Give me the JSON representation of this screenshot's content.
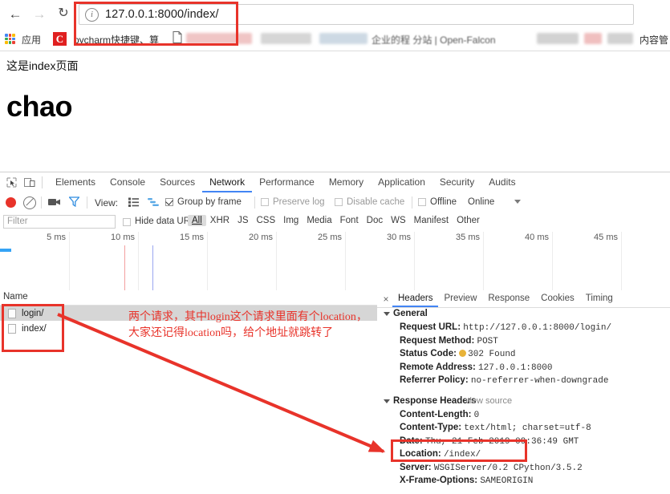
{
  "browser": {
    "back_icon": "back-arrow-icon",
    "forward_icon": "forward-arrow-icon",
    "reload_icon": "reload-icon",
    "info_icon": "ⓘ",
    "url": "127.0.0.1:8000/index/",
    "bookmarks": {
      "apps_label": "应用",
      "c_icon_letter": "C",
      "pycharm_label": "pycharm快捷键、算",
      "open_falcon_label": "企业的程      分站 | Open-Falcon",
      "rightmost_label": "内容管"
    }
  },
  "page": {
    "text": "这是index页面",
    "heading": "chao"
  },
  "devtools": {
    "inspect_icon": "inspect-element-icon",
    "device_toolbar_icon": "device-toolbar-icon",
    "tabs": [
      {
        "label": "Elements",
        "active": false
      },
      {
        "label": "Console",
        "active": false
      },
      {
        "label": "Sources",
        "active": false
      },
      {
        "label": "Network",
        "active": true
      },
      {
        "label": "Performance",
        "active": false
      },
      {
        "label": "Memory",
        "active": false
      },
      {
        "label": "Application",
        "active": false
      },
      {
        "label": "Security",
        "active": false
      },
      {
        "label": "Audits",
        "active": false
      }
    ],
    "toolbar": {
      "record_icon": "record-button-icon",
      "clear_icon": "clear-icon",
      "screenshot_icon": "camera-icon",
      "filter_icon": "funnel-filter-icon",
      "view_label": "View:",
      "view_list_icon": "list-view-icon",
      "view_waterfall_icon": "waterfall-view-icon",
      "group_by_frame_label": "Group by frame",
      "group_by_frame_checked": true,
      "preserve_log_label": "Preserve log",
      "preserve_log_checked": false,
      "disable_cache_label": "Disable cache",
      "disable_cache_checked": false,
      "offline_label": "Offline",
      "offline_checked": false,
      "online_label": "Online",
      "throttling_caret_icon": "chevron-down-icon"
    },
    "filter_row": {
      "placeholder": "Filter",
      "hide_data_urls_label": "Hide data URLs",
      "hide_data_urls_checked": false,
      "resource_types": [
        {
          "label": "All",
          "selected": true
        },
        {
          "label": "XHR",
          "selected": false
        },
        {
          "label": "JS",
          "selected": false
        },
        {
          "label": "CSS",
          "selected": false
        },
        {
          "label": "Img",
          "selected": false
        },
        {
          "label": "Media",
          "selected": false
        },
        {
          "label": "Font",
          "selected": false
        },
        {
          "label": "Doc",
          "selected": false
        },
        {
          "label": "WS",
          "selected": false
        },
        {
          "label": "Manifest",
          "selected": false
        },
        {
          "label": "Other",
          "selected": false
        }
      ]
    },
    "timeline": {
      "ticks": [
        "5 ms",
        "10 ms",
        "15 ms",
        "20 ms",
        "25 ms",
        "30 ms",
        "35 ms",
        "40 ms",
        "45 ms"
      ],
      "dom_content_loaded_color": "#f3a0a0",
      "load_event_color": "#9aa6f0",
      "network_bar_color": "#35a3f5"
    },
    "requests": {
      "column_name": "Name",
      "rows": [
        {
          "name": "login/",
          "selected": true
        },
        {
          "name": "index/",
          "selected": false
        }
      ]
    },
    "detail": {
      "close_icon": "×",
      "tabs": [
        {
          "label": "Headers",
          "active": true
        },
        {
          "label": "Preview",
          "active": false
        },
        {
          "label": "Response",
          "active": false
        },
        {
          "label": "Cookies",
          "active": false
        },
        {
          "label": "Timing",
          "active": false
        }
      ],
      "general": {
        "title": "General",
        "request_url_key": "Request URL:",
        "request_url_value": "http://127.0.0.1:8000/login/",
        "request_method_key": "Request Method:",
        "request_method_value": "POST",
        "status_code_key": "Status Code:",
        "status_code_value": "302 Found",
        "status_dot_color": "#e8b339",
        "remote_address_key": "Remote Address:",
        "remote_address_value": "127.0.0.1:8000",
        "referrer_policy_key": "Referrer Policy:",
        "referrer_policy_value": "no-referrer-when-downgrade"
      },
      "response_headers": {
        "title": "Response Headers",
        "view_source": "view source",
        "lines": [
          {
            "key": "Content-Length:",
            "value": "0"
          },
          {
            "key": "Content-Type:",
            "value": "text/html; charset=utf-8"
          },
          {
            "key": "Date:",
            "value": "Thu, 21 Feb 2019 09:36:49 GMT"
          },
          {
            "key": "Location:",
            "value": "/index/"
          },
          {
            "key": "Server:",
            "value": "WSGIServer/0.2 CPython/3.5.2"
          },
          {
            "key": "X-Frame-Options:",
            "value": "SAMEORIGIN"
          }
        ]
      }
    }
  },
  "annotations": {
    "line1": "两个请求，其中login这个请求里面有个location，",
    "line2": "大家还记得location吗，给个地址就跳转了",
    "highlight_color": "#e8332a"
  }
}
